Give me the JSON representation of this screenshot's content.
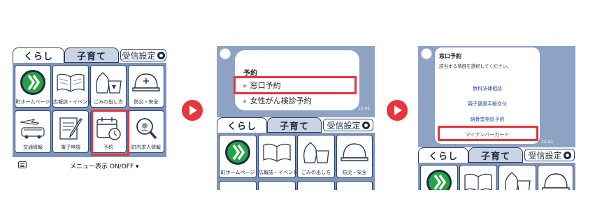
{
  "tabs": {
    "kurashi": "くらし",
    "kosodate": "子育て",
    "settings": "受信設定"
  },
  "menu_items": [
    {
      "label": "町ホームページ",
      "icon": "town-logo-icon"
    },
    {
      "label": "広報誌・イベント",
      "icon": "open-book-icon"
    },
    {
      "label": "ごみの出し方",
      "icon": "garbage-bag-icon"
    },
    {
      "label": "防災・安全",
      "icon": "helmet-icon"
    },
    {
      "label": "交通情報",
      "icon": "transport-icon"
    },
    {
      "label": "電子申請",
      "icon": "document-pen-icon"
    },
    {
      "label": "予約",
      "icon": "calendar-clock-icon"
    },
    {
      "label": "町内求人情報",
      "icon": "magnifier-icon"
    }
  ],
  "menu_toggle": "メニュー表示 ON/OFF ▾",
  "panel2": {
    "title": "予約",
    "options": [
      {
        "label": "窓口予約"
      },
      {
        "label": "女性がん検診予約"
      }
    ],
    "time": "12:41"
  },
  "panel3": {
    "title": "窓口予約",
    "subtitle": "該当する項目を選択してください。",
    "options": [
      {
        "label": "無料法律相談"
      },
      {
        "label": "親子健康手帳交付"
      },
      {
        "label": "納骨堂相談予約"
      },
      {
        "label": "マイナンバーカード"
      }
    ],
    "time": "12:41"
  },
  "colors": {
    "highlight": "#e8353a",
    "grid_bg": "#7d94bd",
    "chat_bg": "#8ea3c4",
    "brand_green": "#22a442",
    "navy": "#2b4472"
  }
}
